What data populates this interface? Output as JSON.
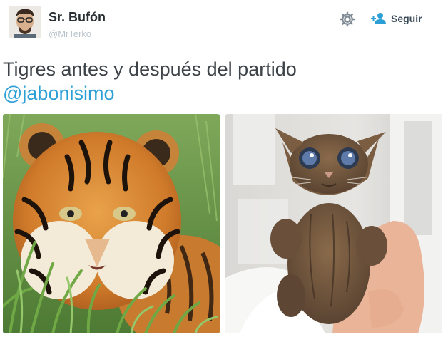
{
  "user": {
    "display_name": "Sr. Bufón",
    "handle": "@MrTerko"
  },
  "actions": {
    "follow_label": "Seguir"
  },
  "tweet": {
    "text": "Tigres antes y después del partido",
    "mention": "@jabonisimo"
  },
  "colors": {
    "link": "#2b9fd6",
    "name": "#292f33",
    "handle": "#b8c3cc"
  },
  "icons": [
    "gear-icon",
    "follow-person-icon"
  ]
}
